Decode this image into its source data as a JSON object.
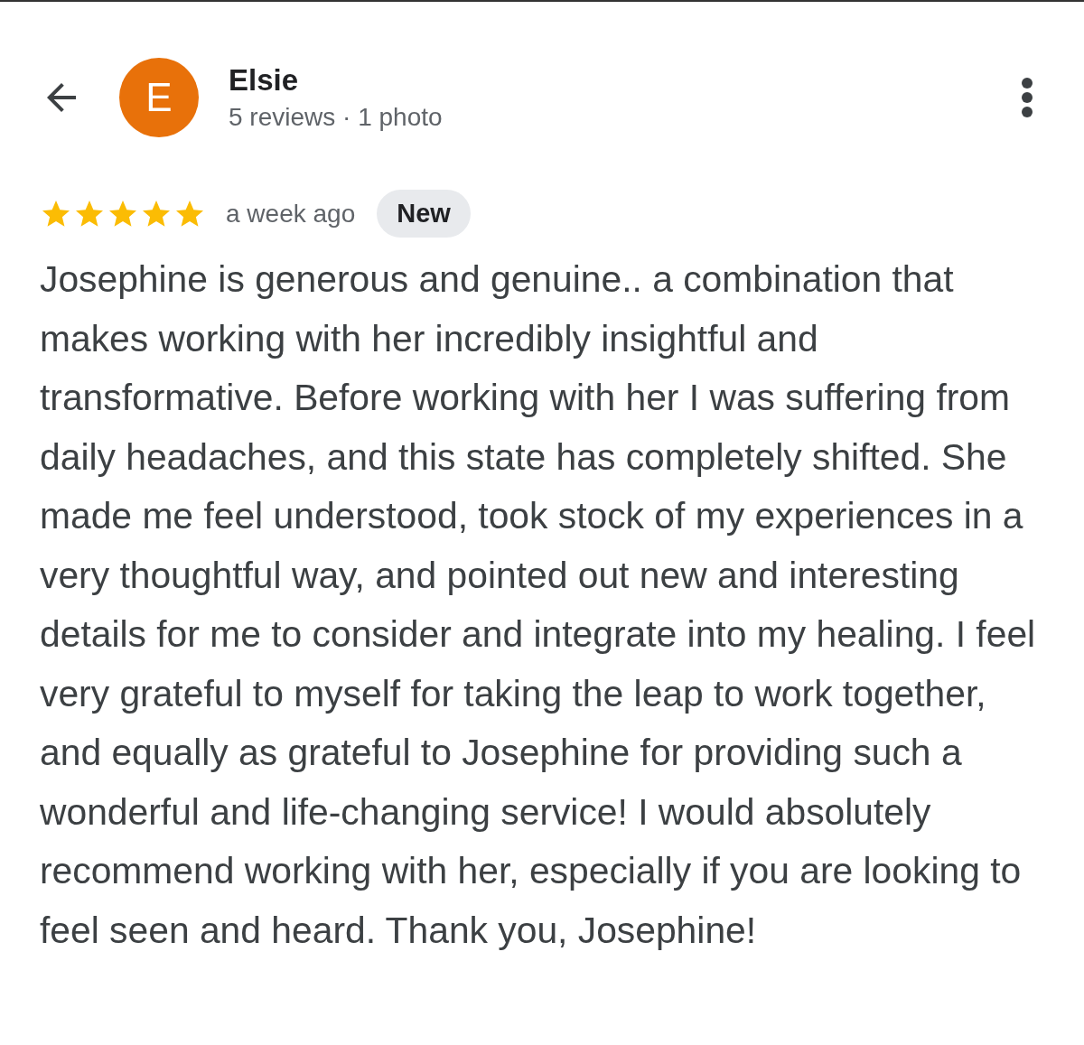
{
  "reviewer": {
    "initial": "E",
    "name": "Elsie",
    "meta": "5 reviews · 1 photo"
  },
  "review": {
    "stars": 5,
    "time": "a week ago",
    "badge": "New",
    "text": "Josephine is generous and genuine.. a combination that makes working with her incredibly insightful and transformative. Before working with her I was suffering from daily headaches, and this state has completely shifted. She made me feel understood, took stock of my experiences in a very thoughtful way, and pointed out new and interesting details for me to consider and integrate into my healing. I feel very grateful to myself for taking the leap to work together, and equally as grateful to Josephine for providing such a wonderful and life-changing service! I would absolutely recommend working with her, especially if you are looking to feel seen and heard. Thank you, Josephine!"
  }
}
